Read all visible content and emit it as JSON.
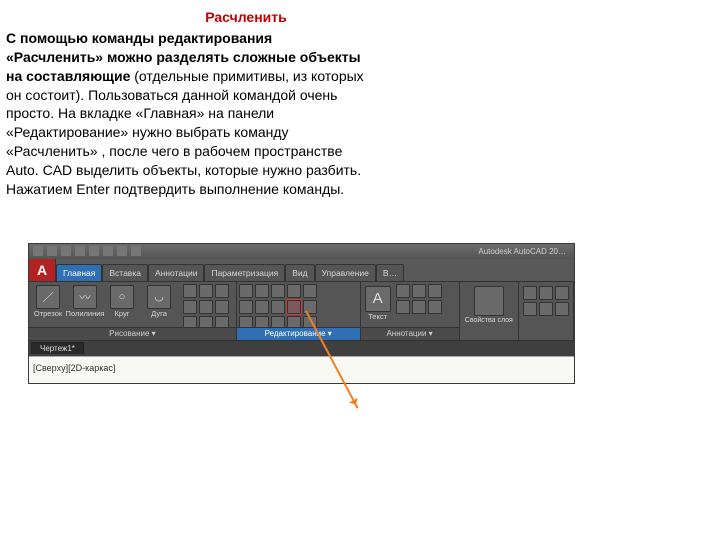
{
  "title": "Расчленить",
  "body_bold": "С помощью команды редактирования «Расчленить» можно разделять сложные объекты на составляющие",
  "body_rest": " (отдельные примитивы, из которых он состоит). Пользоваться данной командой очень просто. На вкладке «Главная» на панели «Редактирование» нужно выбрать команду «Расчленить» , после чего в рабочем пространстве Auto. CAD выделить объекты, которые нужно разбить. Нажатием Enter подтвердить выполнение команды.",
  "app_title": "Autodesk AutoCAD 20…",
  "big_a": "A",
  "tabs": [
    "Главная",
    "Вставка",
    "Аннотации",
    "Параметризация",
    "Вид",
    "Управление",
    "В…"
  ],
  "draw_btns": [
    {
      "lbl": "Отрезок",
      "g": "／"
    },
    {
      "lbl": "Полилиния",
      "g": "〰"
    },
    {
      "lbl": "Круг",
      "g": "○"
    },
    {
      "lbl": "Дуга",
      "g": "◡"
    }
  ],
  "panel_draw": "Рисование ▾",
  "panel_edit": "Редактирование ▾",
  "panel_anno": "Аннотации ▾",
  "text_btn": "Текст",
  "props_btn": "Свойства слоя",
  "doc_tab": "Чертеж1*",
  "vp_label": "[Сверху][2D-каркас]"
}
